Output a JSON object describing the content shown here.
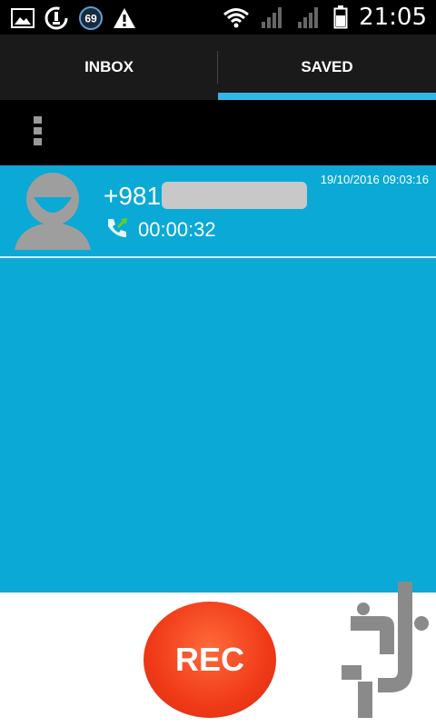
{
  "status_bar": {
    "time": "21:05",
    "notification_badge": "69",
    "icons": [
      "image-icon",
      "sync-icon",
      "badge-icon",
      "warning-icon",
      "wifi-icon",
      "signal-icon",
      "signal-icon",
      "battery-icon"
    ]
  },
  "tabs": [
    {
      "label": "INBOX",
      "selected": false
    },
    {
      "label": "SAVED",
      "selected": true
    }
  ],
  "toolbar": {
    "menu_icon": "overflow-menu-icon"
  },
  "recordings": [
    {
      "number": "+981",
      "timestamp": "19/10/2016 09:03:16",
      "duration": "00:00:32",
      "call_type_icon": "outgoing-call-icon"
    }
  ],
  "record_button": {
    "label": "REC"
  },
  "colors": {
    "list_background": "#0aa9d6",
    "tab_indicator": "#33b5e5",
    "rec_button": "#f03a18",
    "logo_gray": "#8a8a8a"
  }
}
